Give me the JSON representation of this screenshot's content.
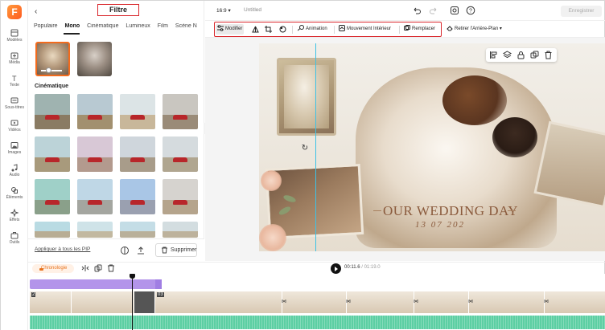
{
  "app": {
    "rail": [
      {
        "label": "Modèles",
        "icon": "templates-icon"
      },
      {
        "label": "Média",
        "icon": "media-icon"
      },
      {
        "label": "Texte",
        "icon": "text-icon"
      },
      {
        "label": "Sous-titres",
        "icon": "subtitles-icon"
      },
      {
        "label": "Vidéos",
        "icon": "video-icon"
      },
      {
        "label": "Images",
        "icon": "image-icon"
      },
      {
        "label": "Audio",
        "icon": "audio-icon"
      },
      {
        "label": "Éléments",
        "icon": "elements-icon"
      },
      {
        "label": "Effets",
        "icon": "effects-icon"
      },
      {
        "label": "Outils",
        "icon": "tools-icon"
      }
    ]
  },
  "panel": {
    "title": "Filtre",
    "tabs": [
      "Populaire",
      "Mono",
      "Cinématique",
      "Lumineux",
      "Film",
      "Scène N"
    ],
    "active_tab": "Mono",
    "section_title": "Cinématique",
    "apply_all": "Appliquer à tous les PIP",
    "delete_label": "Supprimer"
  },
  "topbar": {
    "ratio": "16:9",
    "doc_title": "Untitled",
    "save_label": "Enregistrer"
  },
  "toolbar": {
    "modify": "Modifier",
    "animation": "Animation",
    "motion": "Mouvement Intérieur",
    "replace": "Remplacer",
    "remove_bg": "Retirer l'Arrière-Plan"
  },
  "canvas": {
    "title": "OUR WEDDING DAY",
    "date": "13 07 202"
  },
  "playback": {
    "chrono_label": "Chronologie",
    "current_time": "00:11.6",
    "total_time": "/ 01:19.0"
  },
  "timeline": {
    "clip_labels": [
      "2",
      "03"
    ]
  },
  "colors": {
    "accent": "#f26b1d",
    "highlight_box": "#d9262b",
    "purple_track": "#b394ea",
    "audio_track": "#5ccfa3",
    "guide": "#3dc2e6"
  }
}
